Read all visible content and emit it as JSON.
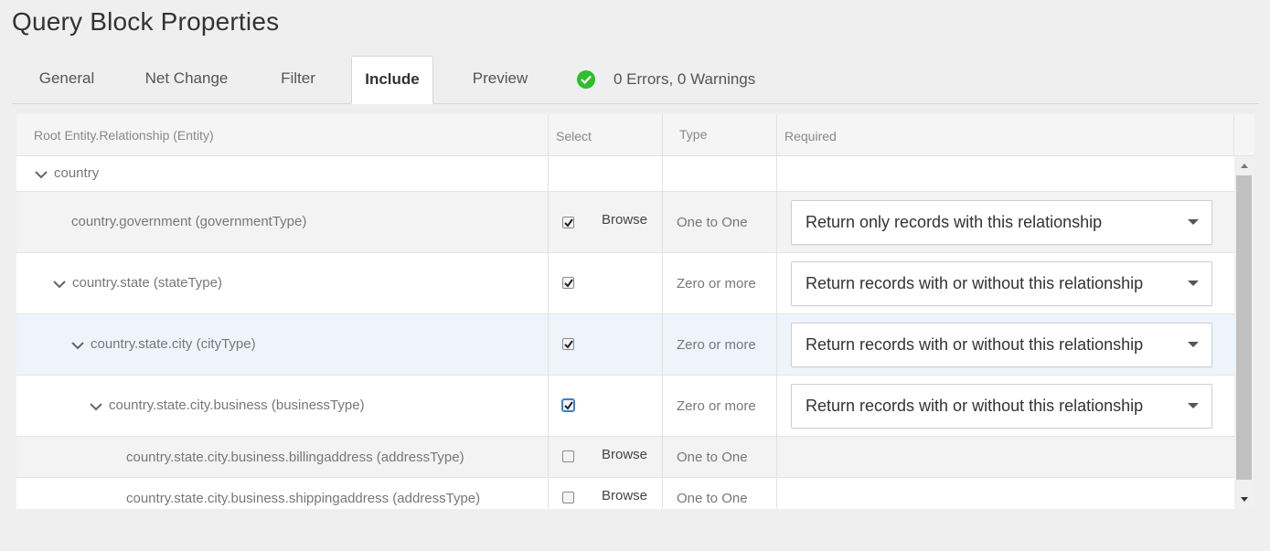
{
  "page": {
    "title": "Query Block Properties"
  },
  "tabs": [
    {
      "label": "General"
    },
    {
      "label": "Net Change"
    },
    {
      "label": "Filter"
    },
    {
      "label": "Include",
      "active": true
    },
    {
      "label": "Preview"
    }
  ],
  "status": {
    "text": "0 Errors, 0 Warnings",
    "icon": "check-circle-icon",
    "color": "#2ebf2e"
  },
  "grid": {
    "columns": [
      "Root Entity.Relationship (Entity)",
      "Select",
      "Type",
      "Required"
    ],
    "rows": [
      {
        "name": "country",
        "expandable": true
      },
      {
        "name": "country.government (governmentType)",
        "checked": true,
        "browse": "Browse",
        "type": "One to One",
        "required": "Return only records with this relationship"
      },
      {
        "name": "country.state (stateType)",
        "expandable": true,
        "checked": true,
        "type": "Zero or more",
        "required": "Return records with or without this relationship"
      },
      {
        "name": "country.state.city (cityType)",
        "expandable": true,
        "checked": true,
        "type": "Zero or more",
        "required": "Return records with or without this relationship"
      },
      {
        "name": "country.state.city.business (businessType)",
        "expandable": true,
        "checked": true,
        "type": "Zero or more",
        "required": "Return records with or without this relationship"
      },
      {
        "name": "country.state.city.business.billingaddress (addressType)",
        "checked": false,
        "browse": "Browse",
        "type": "One to One"
      },
      {
        "name": "country.state.city.business.shippingaddress (addressType)",
        "checked": false,
        "browse": "Browse",
        "type": "One to One"
      }
    ]
  }
}
